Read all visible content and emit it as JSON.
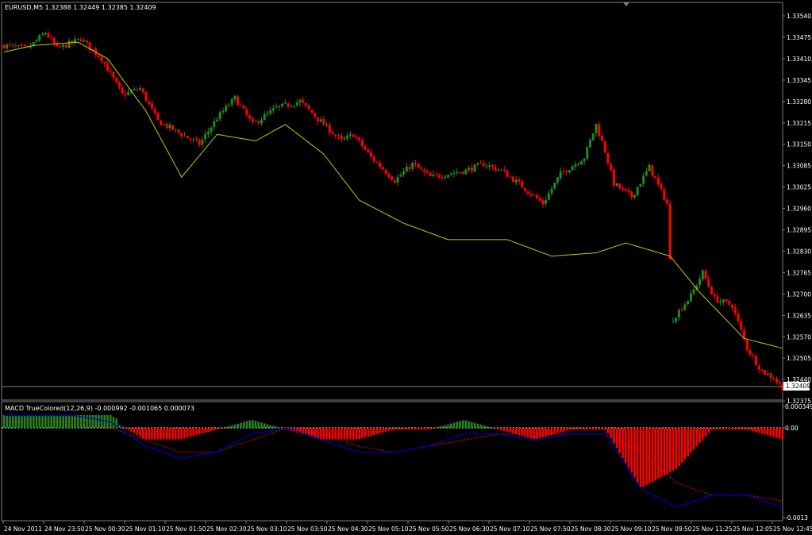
{
  "main_panel": {
    "symbol_header": "EURUSD,M5  1.32388 1.32449 1.32385 1.32409",
    "current_price_label": "1.32409",
    "price_ticks": [
      "1.33540",
      "1.33475",
      "1.33410",
      "1.33345",
      "1.33280",
      "1.33215",
      "1.33150",
      "1.33085",
      "1.33025",
      "1.32960",
      "1.32895",
      "1.32830",
      "1.32765",
      "1.32700",
      "1.32635",
      "1.32570",
      "1.32505",
      "1.32440",
      "1.32375"
    ],
    "colors": {
      "up": "#1f8a1f",
      "down": "#ff0000",
      "ma": "#c8c800",
      "background": "#000000",
      "frame": "#808080"
    }
  },
  "macd_panel": {
    "header": "MACD TrueColored(12,26,9) -0.000992 -0.001065 0.000073",
    "ticks": [
      "0.000349",
      "0.00",
      "-0.0013"
    ],
    "colors": {
      "hist_up": "#1f8a1f",
      "hist_down": "#ff0000",
      "macd": "#0000c8",
      "signal": "#ff0000"
    }
  },
  "time_axis": {
    "labels": [
      "24 Nov 2011",
      "24 Nov 23:50",
      "25 Nov 00:30",
      "25 Nov 01:10",
      "25 Nov 01:50",
      "25 Nov 02:30",
      "25 Nov 03:10",
      "25 Nov 03:50",
      "25 Nov 04:30",
      "25 Nov 05:10",
      "25 Nov 05:50",
      "25 Nov 06:30",
      "25 Nov 07:10",
      "25 Nov 07:50",
      "25 Nov 08:30",
      "25 Nov 09:10",
      "25 Nov 09:50",
      "25 Nov 11:25",
      "25 Nov 12:05",
      "25 Nov 12:45"
    ]
  },
  "chart_data": {
    "type": "candlestick",
    "symbol": "EURUSD",
    "timeframe": "M5",
    "ylim": [
      1.3234,
      1.3358
    ],
    "ma_anchors": [
      [
        0,
        1.3343
      ],
      [
        10,
        1.3345
      ],
      [
        25,
        1.3346
      ],
      [
        35,
        1.3341
      ],
      [
        48,
        1.3325
      ],
      [
        60,
        1.3305
      ],
      [
        72,
        1.3318
      ],
      [
        85,
        1.3316
      ],
      [
        95,
        1.3321
      ],
      [
        108,
        1.3312
      ],
      [
        120,
        1.3298
      ],
      [
        135,
        1.3291
      ],
      [
        150,
        1.3286
      ],
      [
        170,
        1.3286
      ],
      [
        185,
        1.3281
      ],
      [
        200,
        1.3282
      ],
      [
        210,
        1.3285
      ],
      [
        225,
        1.3281
      ],
      [
        235,
        1.327
      ],
      [
        250,
        1.3256
      ],
      [
        263,
        1.3253
      ]
    ],
    "close_anchors": [
      [
        0,
        1.3345
      ],
      [
        8,
        1.3344
      ],
      [
        14,
        1.3349
      ],
      [
        18,
        1.3344
      ],
      [
        26,
        1.3347
      ],
      [
        33,
        1.3341
      ],
      [
        40,
        1.333
      ],
      [
        46,
        1.3332
      ],
      [
        52,
        1.3322
      ],
      [
        58,
        1.3319
      ],
      [
        66,
        1.3315
      ],
      [
        72,
        1.3323
      ],
      [
        78,
        1.3329
      ],
      [
        84,
        1.3321
      ],
      [
        92,
        1.3326
      ],
      [
        100,
        1.3328
      ],
      [
        108,
        1.3321
      ],
      [
        114,
        1.3316
      ],
      [
        118,
        1.3318
      ],
      [
        124,
        1.3311
      ],
      [
        132,
        1.3304
      ],
      [
        138,
        1.3309
      ],
      [
        144,
        1.3305
      ],
      [
        150,
        1.3306
      ],
      [
        156,
        1.3307
      ],
      [
        162,
        1.3309
      ],
      [
        168,
        1.3307
      ],
      [
        174,
        1.3303
      ],
      [
        182,
        1.3297
      ],
      [
        188,
        1.3306
      ],
      [
        196,
        1.3311
      ],
      [
        200,
        1.3321
      ],
      [
        203,
        1.3313
      ],
      [
        206,
        1.3303
      ],
      [
        212,
        1.3299
      ],
      [
        218,
        1.3308
      ],
      [
        224,
        1.3297
      ],
      [
        226,
        1.3262
      ],
      [
        232,
        1.3269
      ],
      [
        236,
        1.3276
      ],
      [
        240,
        1.3268
      ],
      [
        246,
        1.3266
      ],
      [
        251,
        1.3253
      ],
      [
        256,
        1.3246
      ],
      [
        260,
        1.3244
      ],
      [
        263,
        1.3241
      ]
    ],
    "macd": {
      "macd_line": [
        0.0002,
        0.0002,
        0.0002,
        0.0001,
        -0.0003,
        -0.0005,
        -0.0004,
        -0.0001,
        0.0,
        -0.0002,
        -0.0004,
        -0.0004,
        -0.0003,
        -0.0001,
        -0.0001,
        -0.0002,
        -0.0001,
        -0.0001,
        -0.001,
        -0.0013,
        -0.0011,
        -0.0011,
        -0.0013
      ],
      "signal_line": [
        0.0001,
        0.0001,
        0.0001,
        0.0,
        -0.0002,
        -0.0004,
        -0.0004,
        -0.0002,
        0.0,
        -0.0001,
        -0.0003,
        -0.0004,
        -0.0003,
        -0.0002,
        -0.0001,
        -0.0001,
        -0.0001,
        -0.0001,
        -0.0004,
        -0.0009,
        -0.0011,
        -0.0011,
        -0.0012
      ]
    }
  }
}
